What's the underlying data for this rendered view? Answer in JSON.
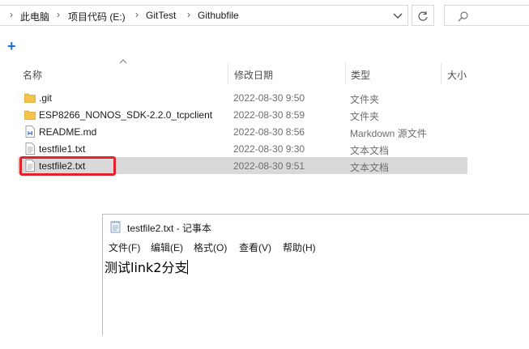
{
  "explorer": {
    "breadcrumbs": [
      "此电脑",
      "项目代码 (E:)",
      "GitTest",
      "Githubfile"
    ],
    "columns": {
      "name": "名称",
      "date": "修改日期",
      "type": "类型",
      "size": "大小"
    },
    "files": [
      {
        "name": ".git",
        "date": "2022-08-30 9:50",
        "type": "文件夹",
        "icon": "folder-icon"
      },
      {
        "name": "ESP8266_NONOS_SDK-2.2.0_tcpclient",
        "date": "2022-08-30 8:59",
        "type": "文件夹",
        "icon": "folder-icon"
      },
      {
        "name": "README.md",
        "date": "2022-08-30 8:56",
        "type": "Markdown 源文件",
        "icon": "markdown-file-icon"
      },
      {
        "name": "testfile1.txt",
        "date": "2022-08-30 9:30",
        "type": "文本文档",
        "icon": "text-file-icon"
      },
      {
        "name": "testfile2.txt",
        "date": "2022-08-30 9:51",
        "type": "文本文档",
        "icon": "text-file-icon",
        "selected": true
      }
    ]
  },
  "notepad": {
    "title": "testfile2.txt - 记事本",
    "menu": [
      "文件(F)",
      "编辑(E)",
      "格式(O)",
      "查看(V)",
      "帮助(H)"
    ],
    "content": "测试link2分支"
  },
  "colors": {
    "highlight": "#e2222a",
    "selection": "#d9d9d9",
    "accent": "#1f6fd0",
    "folder": "#f4c44a"
  }
}
